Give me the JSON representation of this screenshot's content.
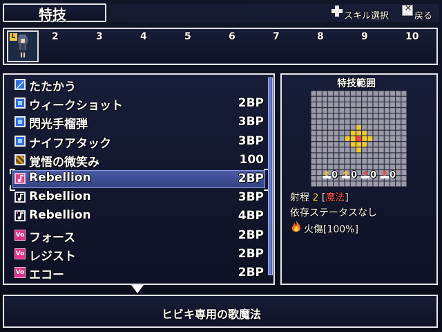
{
  "header": {
    "title": "特技",
    "skill_select_label": "スキル選択",
    "back_label": "戻る",
    "dpad_icon": "dpad-icon",
    "x_button_icon": "x-button-icon",
    "x_button_glyph": "✕"
  },
  "party": {
    "leader_badge": "L",
    "slots": [
      "2",
      "3",
      "4",
      "5",
      "6",
      "7",
      "8",
      "9",
      "10"
    ]
  },
  "skills": [
    {
      "name": "たたかう",
      "cost": "",
      "icon": "sword-icon"
    },
    {
      "name": "ウィークショット",
      "cost": "2BP",
      "icon": "blue-square-icon"
    },
    {
      "name": "閃光手榴弾",
      "cost": "3BP",
      "icon": "blue-square-icon"
    },
    {
      "name": "ナイフアタック",
      "cost": "3BP",
      "icon": "blue-square-icon"
    },
    {
      "name": "覚悟の微笑み",
      "cost": "100",
      "icon": "gold-pattern-icon"
    },
    {
      "name": "Rebellion",
      "cost": "2BP",
      "icon": "music-note-icon"
    },
    {
      "name": "Rebellion",
      "cost": "3BP",
      "icon": "sparkle-note-icon"
    },
    {
      "name": "Rebellion",
      "cost": "4BP",
      "icon": "sparkle-note-icon"
    },
    {
      "name": "フォース",
      "cost": "2BP",
      "icon": "vo-icon"
    },
    {
      "name": "レジスト",
      "cost": "2BP",
      "icon": "vo-icon"
    },
    {
      "name": "エコー",
      "cost": "2BP",
      "icon": "vo-icon"
    }
  ],
  "selected_index": 5,
  "vo_glyph": "Vo",
  "range_panel": {
    "title": "特技範囲",
    "stat_values": [
      "0",
      "0",
      "0",
      "0"
    ],
    "range_label": "射程",
    "range_value": "2",
    "range_type": "魔法",
    "bracket_open": "[",
    "bracket_close": "]",
    "status_text": "依存ステータスなし",
    "burn_text": "火傷[100%]"
  },
  "description": "ヒビキ専用の歌魔法",
  "colors": {
    "accent_yellow": "#f2e24a",
    "accent_red": "#ff5a5a",
    "selection": "#4a5ca8",
    "grid_cell": "#9a9aa8",
    "grid_hit": "#f0c830"
  }
}
